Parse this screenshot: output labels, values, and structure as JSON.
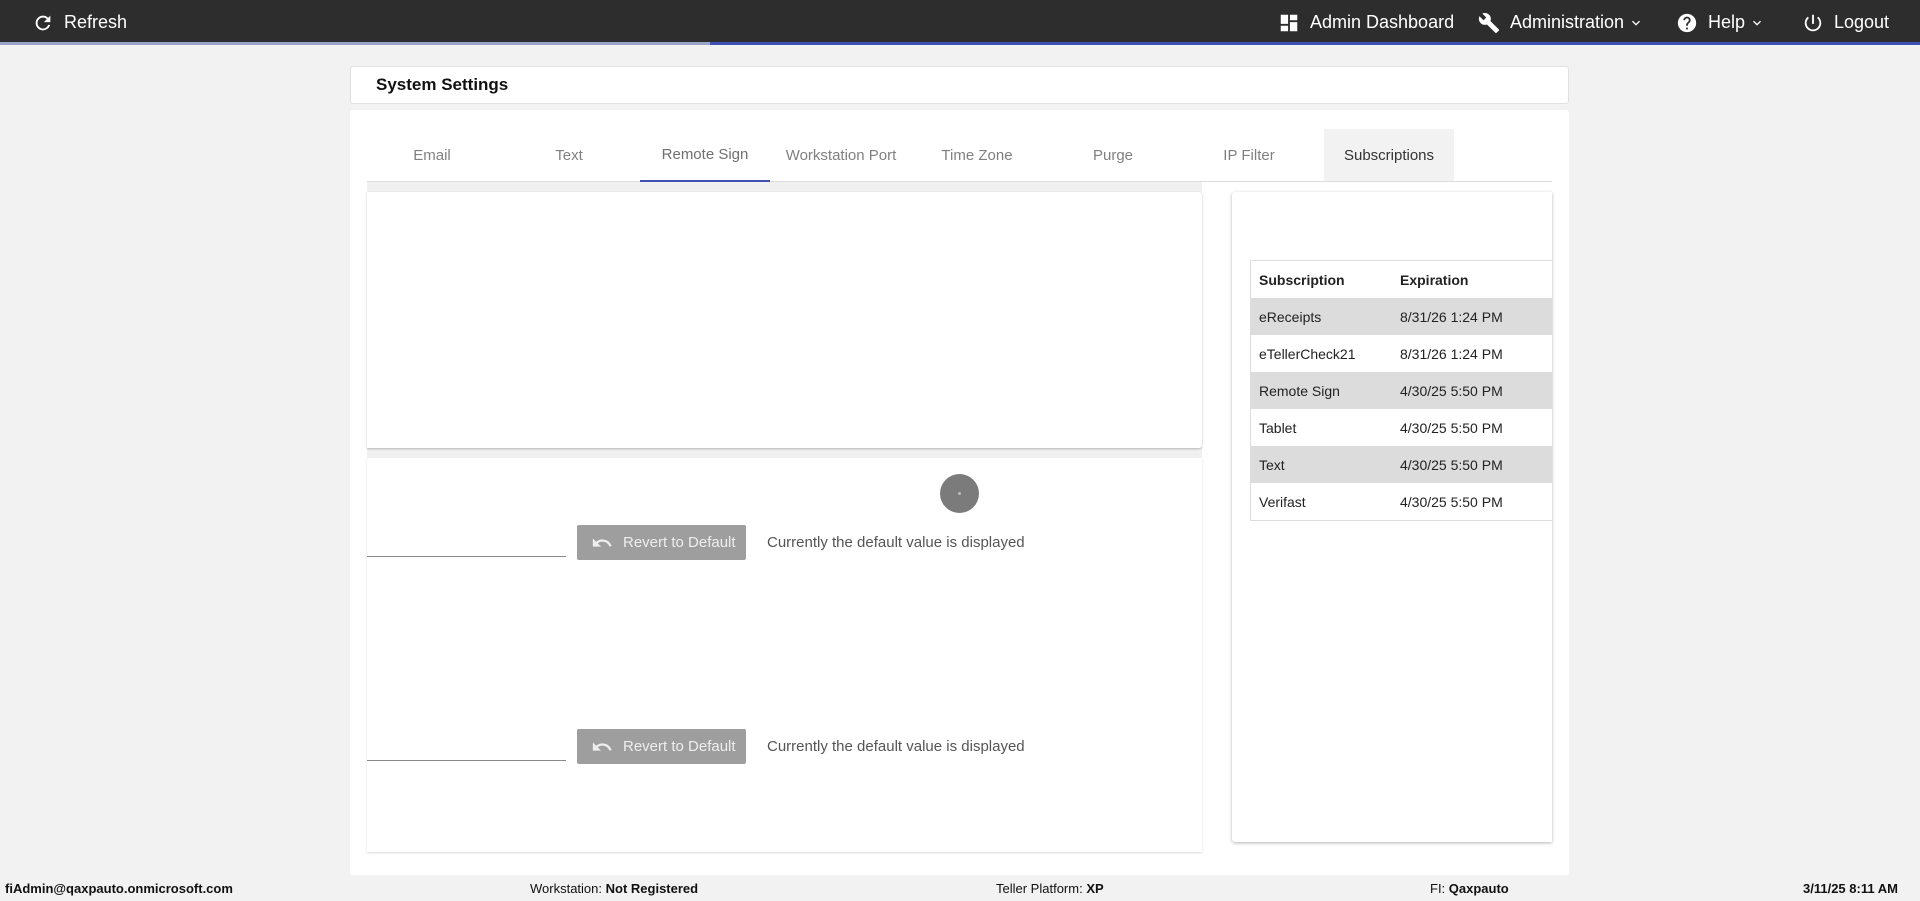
{
  "topbar": {
    "refresh_label": "Refresh",
    "admin_dashboard_label": "Admin Dashboard",
    "administration_label": "Administration",
    "help_label": "Help",
    "logout_label": "Logout",
    "progress_fraction": 0.63
  },
  "page": {
    "title": "System Settings"
  },
  "tabs": [
    {
      "label": "Email"
    },
    {
      "label": "Text"
    },
    {
      "label": "Remote Sign"
    },
    {
      "label": "Workstation Port"
    },
    {
      "label": "Time Zone"
    },
    {
      "label": "Purge"
    },
    {
      "label": "IP Filter"
    },
    {
      "label": "Subscriptions"
    }
  ],
  "settings": [
    {
      "revert_label": "Revert to Default",
      "status": "Currently the default value is displayed"
    },
    {
      "revert_label": "Revert to Default",
      "status": "Currently the default value is displayed"
    }
  ],
  "subscriptions": {
    "headers": [
      "Subscription",
      "Expiration"
    ],
    "rows": [
      {
        "name": "eReceipts",
        "expiration": "8/31/26 1:24 PM"
      },
      {
        "name": "eTellerCheck21",
        "expiration": "8/31/26 1:24 PM"
      },
      {
        "name": "Remote Sign",
        "expiration": "4/30/25 5:50 PM"
      },
      {
        "name": "Tablet",
        "expiration": "4/30/25 5:50 PM"
      },
      {
        "name": "Text",
        "expiration": "4/30/25 5:50 PM"
      },
      {
        "name": "Verifast",
        "expiration": "4/30/25 5:50 PM"
      }
    ]
  },
  "footer": {
    "user": "fiAdmin@qaxpauto.onmicrosoft.com",
    "workstation_label": "Workstation:",
    "workstation_value": "Not Registered",
    "platform_label": "Teller Platform:",
    "platform_value": "XP",
    "fi_label": "FI:",
    "fi_value": "Qaxpauto",
    "datetime": "3/11/25 8:11 AM"
  },
  "colors": {
    "topbar_bg": "#2d2d2d",
    "accent": "#3f51b5",
    "revert_button_bg": "#9e9e9e"
  }
}
